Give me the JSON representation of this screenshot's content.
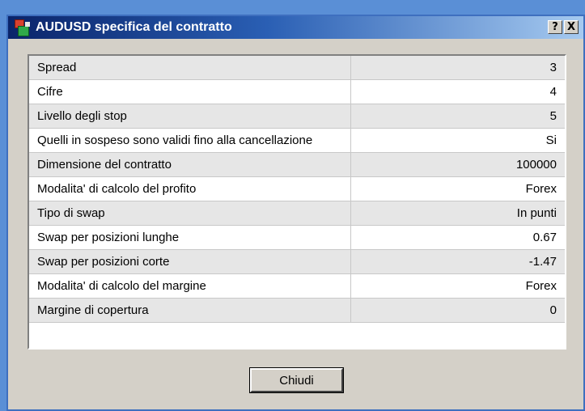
{
  "window": {
    "title": "AUDUSD specifica del contratto",
    "help_button": "?",
    "close_button": "X"
  },
  "rows": [
    {
      "label": "Spread",
      "value": "3"
    },
    {
      "label": "Cifre",
      "value": "4"
    },
    {
      "label": "Livello degli stop",
      "value": "5"
    },
    {
      "label": "Quelli in sospeso sono validi fino alla cancellazione",
      "value": "Si"
    },
    {
      "label": "Dimensione del contratto",
      "value": "100000"
    },
    {
      "label": "Modalita' di calcolo del profito",
      "value": "Forex"
    },
    {
      "label": "Tipo di swap",
      "value": "In punti"
    },
    {
      "label": "Swap per posizioni lunghe",
      "value": "0.67"
    },
    {
      "label": "Swap per posizioni corte",
      "value": "-1.47"
    },
    {
      "label": "Modalita' di calcolo del margine",
      "value": "Forex"
    },
    {
      "label": "Margine di copertura",
      "value": "0"
    }
  ],
  "footer": {
    "close_label": "Chiudi"
  }
}
